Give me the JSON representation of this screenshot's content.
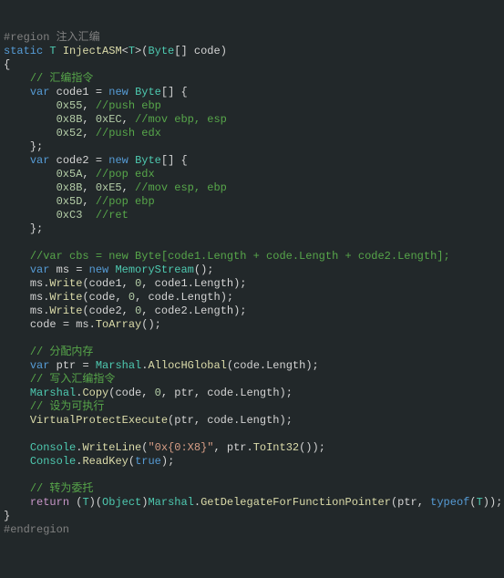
{
  "l1a": "#region",
  "l1b": " 注入汇编",
  "l2a": "static",
  "l2b": "T",
  "l2c": "InjectASM",
  "l2d": "T",
  "l2e": "Byte",
  "l2f": "code",
  "l3": "{",
  "l4": "// 汇编指令",
  "l5a": "var",
  "l5b": "code1",
  "l5c": "new",
  "l5d": "Byte",
  "l6a": "0x55",
  "l6b": "//push ebp",
  "l7a": "0x8B",
  "l7b": "0xEC",
  "l7c": "//mov ebp, esp",
  "l8a": "0x52",
  "l8b": "//push edx",
  "l9": "};",
  "l10a": "var",
  "l10b": "code2",
  "l10c": "new",
  "l10d": "Byte",
  "l11a": "0x5A",
  "l11b": "//pop edx",
  "l12a": "0x8B",
  "l12b": "0xE5",
  "l12c": "//mov esp, ebp",
  "l13a": "0x5D",
  "l13b": "//pop ebp",
  "l14a": "0xC3",
  "l14b": "//ret",
  "l15": "};",
  "l17": "//var cbs = new Byte[code1.Length + code.Length + code2.Length];",
  "l18a": "var",
  "l18b": "ms",
  "l18c": "new",
  "l18d": "MemoryStream",
  "l19a": "ms",
  "l19b": "Write",
  "l19c": "code1",
  "l19d": "0",
  "l19e": "code1",
  "l19f": "Length",
  "l20a": "ms",
  "l20b": "Write",
  "l20c": "code",
  "l20d": "0",
  "l20e": "code",
  "l20f": "Length",
  "l21a": "ms",
  "l21b": "Write",
  "l21c": "code2",
  "l21d": "0",
  "l21e": "code2",
  "l21f": "Length",
  "l22a": "code",
  "l22b": "ms",
  "l22c": "ToArray",
  "l24": "// 分配内存",
  "l25a": "var",
  "l25b": "ptr",
  "l25c": "Marshal",
  "l25d": "AllocHGlobal",
  "l25e": "code",
  "l25f": "Length",
  "l26": "// 写入汇编指令",
  "l27a": "Marshal",
  "l27b": "Copy",
  "l27c": "code",
  "l27d": "0",
  "l27e": "ptr",
  "l27f": "code",
  "l27g": "Length",
  "l28": "// 设为可执行",
  "l29a": "VirtualProtectExecute",
  "l29b": "ptr",
  "l29c": "code",
  "l29d": "Length",
  "l31a": "Console",
  "l31b": "WriteLine",
  "l31c": "\"0x{0:X8}\"",
  "l31d": "ptr",
  "l31e": "ToInt32",
  "l32a": "Console",
  "l32b": "ReadKey",
  "l32c": "true",
  "l34": "// 转为委托",
  "l35a": "return",
  "l35b": "T",
  "l35c": "Object",
  "l35d": "Marshal",
  "l35e": "GetDelegateForFunctionPointer",
  "l35f": "ptr",
  "l35g": "typeof",
  "l35h": "T",
  "l36": "}",
  "l37": "#endregion"
}
